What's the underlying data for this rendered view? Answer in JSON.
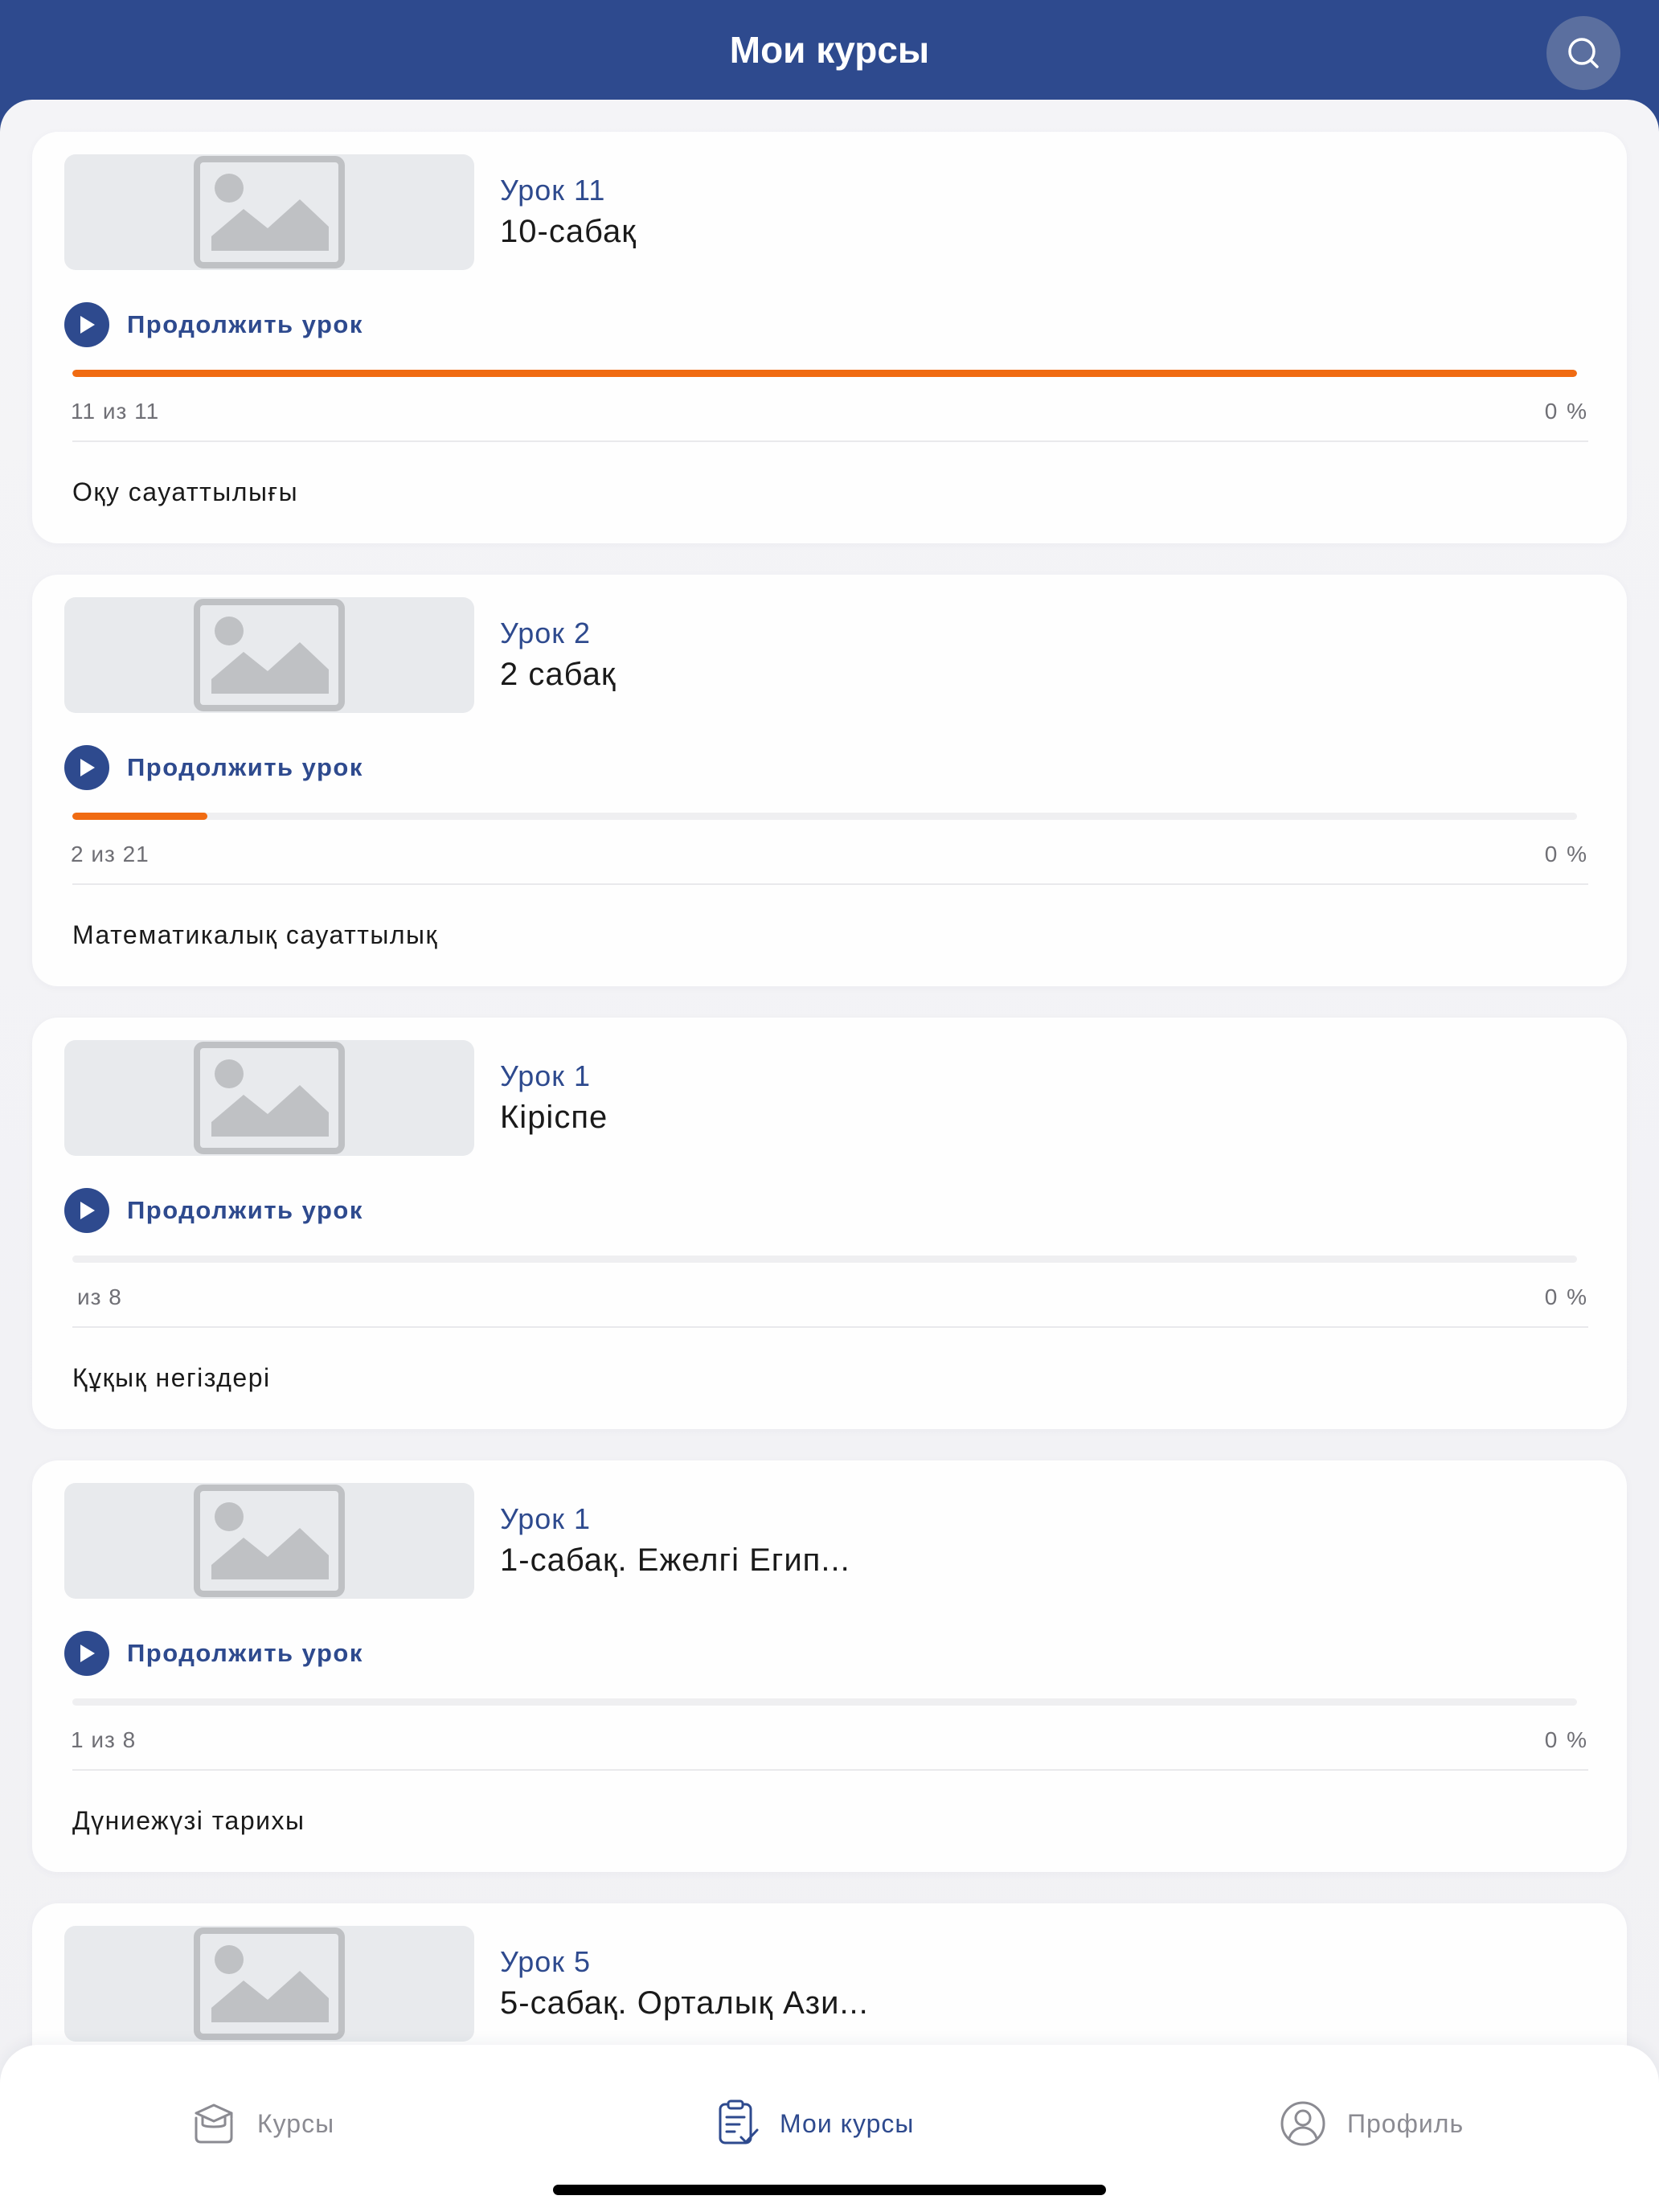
{
  "header": {
    "title": "Мои курсы",
    "search_icon": "search-icon"
  },
  "colors": {
    "brand": "#2e4a8e",
    "progress": "#f06b12",
    "track": "#efeff1"
  },
  "continue_label": "Продолжить урок",
  "cards": [
    {
      "lesson_number": "Урок 11",
      "lesson_title": "10-сабақ",
      "count": "11 из 11",
      "percent": "0 %",
      "progress_fraction": 1.0,
      "course_name": "Оқу сауаттылығы"
    },
    {
      "lesson_number": "Урок 2",
      "lesson_title": "2 сабақ",
      "count": "2 из 21",
      "percent": "0 %",
      "progress_fraction": 0.09,
      "course_name": "Математикалық сауаттылық"
    },
    {
      "lesson_number": "Урок 1",
      "lesson_title": "Кіріспе",
      "count": "из 8",
      "percent": "0 %",
      "progress_fraction": 0,
      "course_name": "Құқық негіздері"
    },
    {
      "lesson_number": "Урок 1",
      "lesson_title": "1-сабақ. Ежелгі Егип...",
      "count": "1 из 8",
      "percent": "0 %",
      "progress_fraction": 0,
      "course_name": "Дүниежүзі тарихы"
    },
    {
      "lesson_number": "Урок 5",
      "lesson_title": "5-сабақ. Орталық Ази...",
      "count": "",
      "percent": "",
      "progress_fraction": 0,
      "course_name": ""
    }
  ],
  "tabbar": {
    "courses": {
      "label": "Курсы",
      "icon": "graduation-cap-icon"
    },
    "my_courses": {
      "label": "Мои курсы",
      "icon": "checklist-icon",
      "active": true
    },
    "profile": {
      "label": "Профиль",
      "icon": "user-circle-icon"
    }
  }
}
